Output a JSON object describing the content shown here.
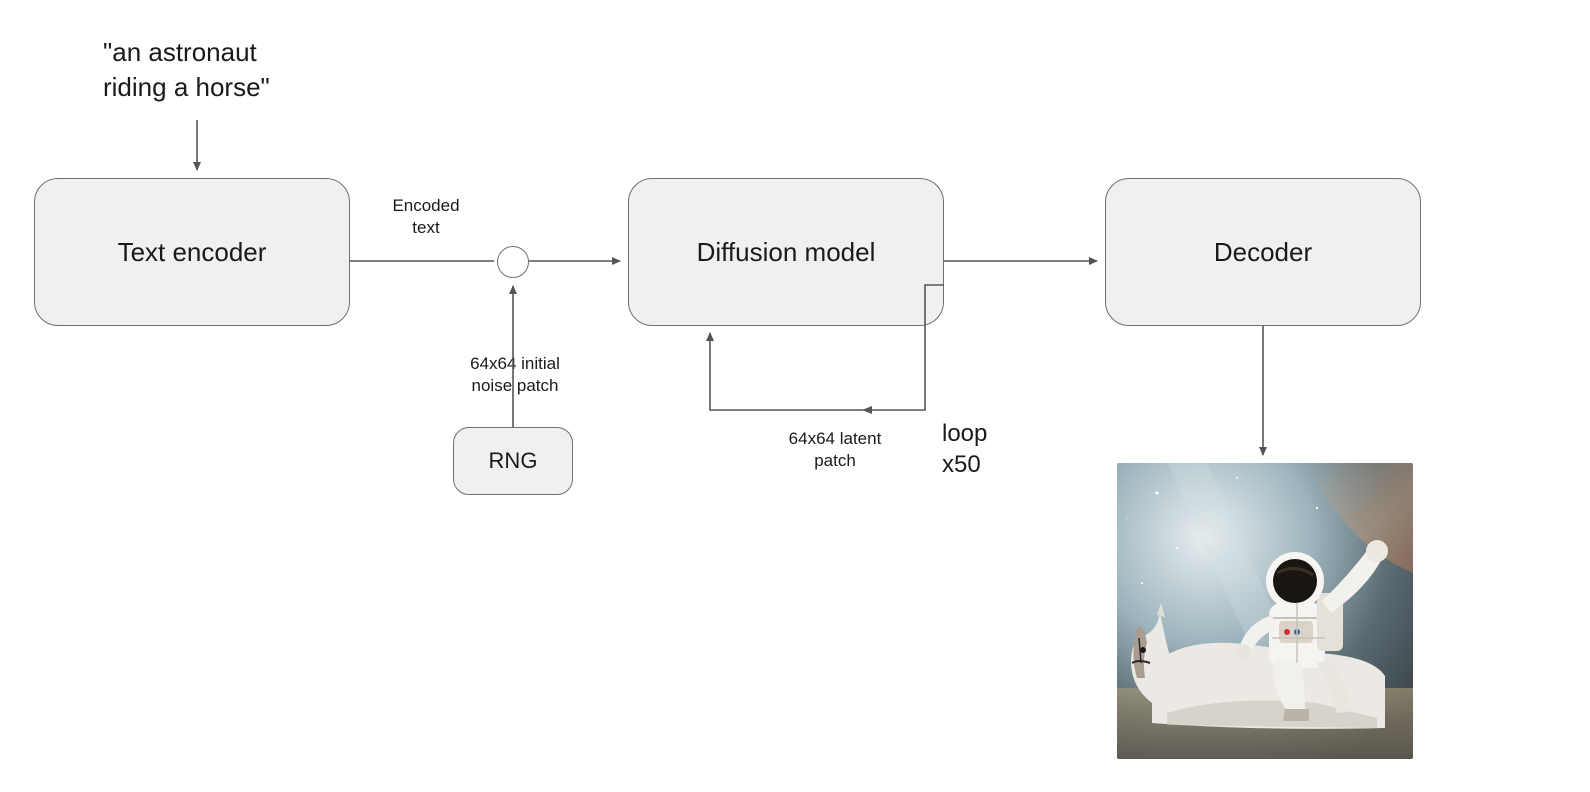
{
  "prompt": {
    "line1": "\"an astronaut",
    "line2": "riding a horse\""
  },
  "nodes": {
    "text_encoder": "Text encoder",
    "diffusion_model": "Diffusion model",
    "decoder": "Decoder",
    "rng": "RNG"
  },
  "labels": {
    "encoded_text_line1": "Encoded",
    "encoded_text_line2": "text",
    "noise_patch_line1": "64x64 initial",
    "noise_patch_line2": "noise patch",
    "latent_patch_line1": "64x64 latent",
    "latent_patch_line2": "patch",
    "loop_line1": "loop",
    "loop_line2": "x50"
  },
  "output": {
    "alt": "Generated image: astronaut riding a horse"
  }
}
